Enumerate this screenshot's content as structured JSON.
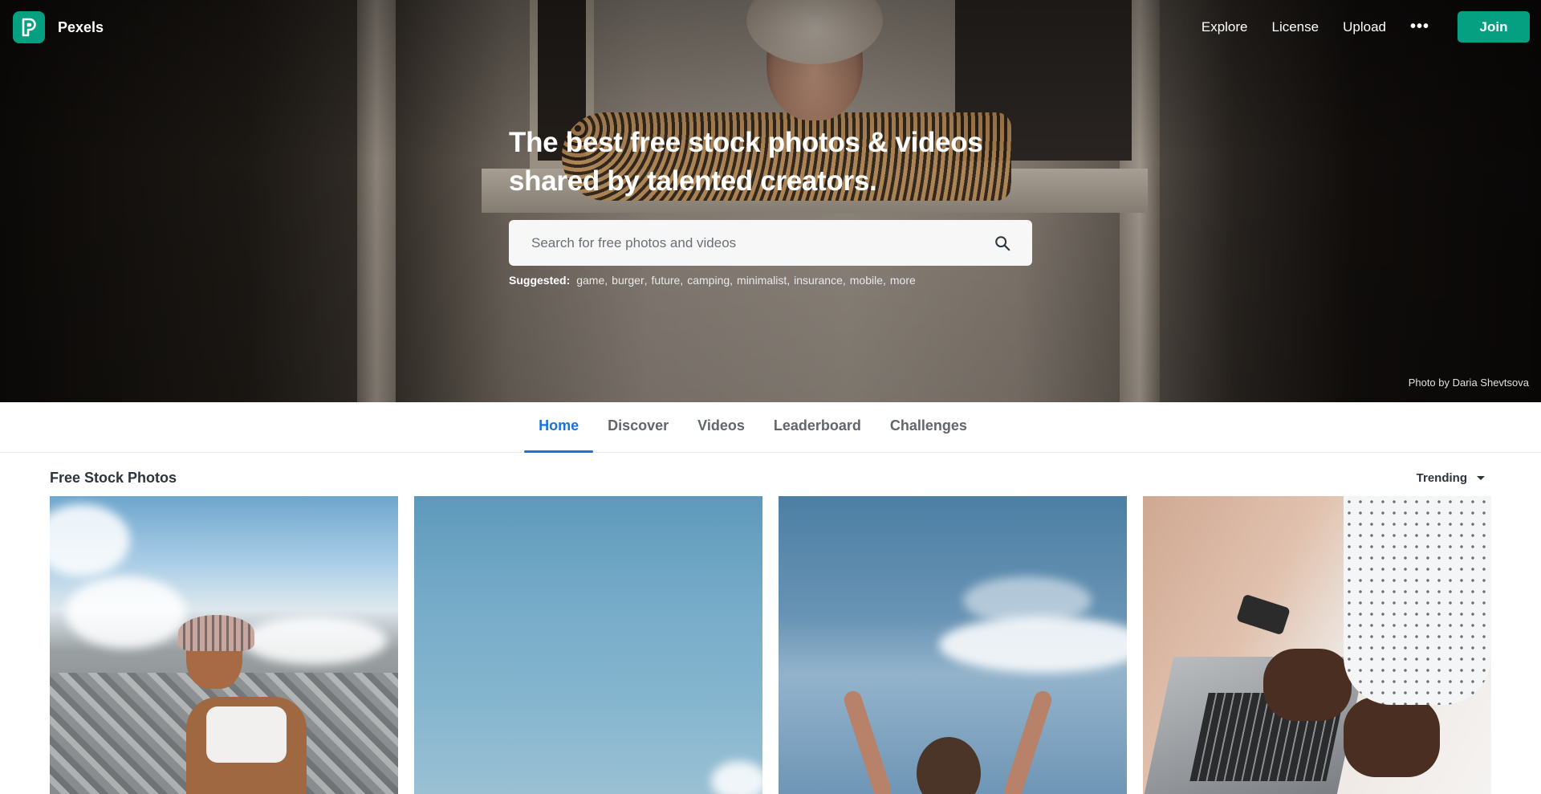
{
  "brand": {
    "name": "Pexels",
    "color": "#05a081"
  },
  "nav": {
    "links": [
      "Explore",
      "License",
      "Upload"
    ],
    "more": "•••",
    "join": "Join"
  },
  "hero": {
    "title": "The best free stock photos & videos shared by talented creators.",
    "search_placeholder": "Search for free photos and videos",
    "suggested_label": "Suggested:",
    "suggestions": [
      "game",
      "burger",
      "future",
      "camping",
      "minimalist",
      "insurance",
      "mobile",
      "more"
    ],
    "credit": "Photo by Daria Shevtsova"
  },
  "tabs": {
    "items": [
      "Home",
      "Discover",
      "Videos",
      "Leaderboard",
      "Challenges"
    ],
    "active": "Home",
    "active_color": "#1a74d8"
  },
  "section": {
    "title": "Free Stock Photos",
    "sort": "Trending"
  },
  "icons": {
    "logo": "pexels-logo-icon",
    "search": "search-icon",
    "more": "more-dots-icon",
    "caret": "caret-down-icon"
  }
}
